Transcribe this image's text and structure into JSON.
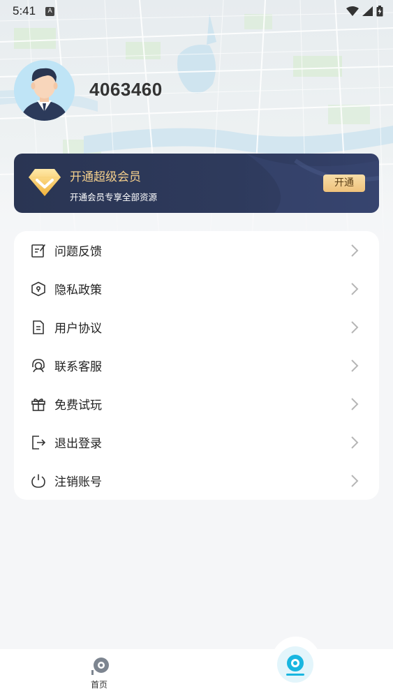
{
  "status_bar": {
    "time": "5:41",
    "notification_icon": "text-a-icon",
    "icons": [
      "wifi-icon",
      "cellular-signal-icon",
      "battery-charging-icon"
    ]
  },
  "profile": {
    "avatar_icon": "user-avatar-icon",
    "username": "4063460"
  },
  "vip": {
    "icon": "diamond-icon",
    "title": "开通超级会员",
    "subtitle": "开通会员专享全部资源",
    "button_label": "开通",
    "colors": {
      "banner": "#2c3757",
      "title": "#f4cf8c",
      "button": "#f2c988"
    }
  },
  "menu": {
    "items": [
      {
        "label": "问题反馈",
        "icon": "feedback-edit-icon"
      },
      {
        "label": "隐私政策",
        "icon": "privacy-shield-icon"
      },
      {
        "label": "用户协议",
        "icon": "document-icon"
      },
      {
        "label": "联系客服",
        "icon": "customer-service-icon"
      },
      {
        "label": "免费试玩",
        "icon": "gift-icon"
      },
      {
        "label": "退出登录",
        "icon": "logout-icon"
      },
      {
        "label": "注销账号",
        "icon": "power-icon"
      }
    ],
    "chevron_icon": "chevron-right-icon"
  },
  "bottom_nav": {
    "home_label": "首页",
    "home_icon": "home-camera-icon",
    "center_icon": "camera-lens-icon",
    "accent": "#19b6e0"
  }
}
